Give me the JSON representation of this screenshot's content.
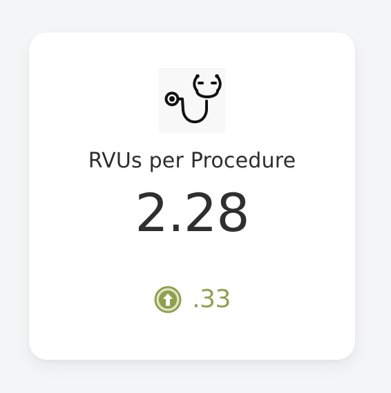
{
  "kpi_card": {
    "title": "RVUs per Procedure",
    "value": "2.28",
    "change": {
      "direction": "up",
      "value": ".33",
      "icon": "arrow-up-circle-icon",
      "color": "#8ea150"
    },
    "header_icon": "stethoscope-icon"
  }
}
